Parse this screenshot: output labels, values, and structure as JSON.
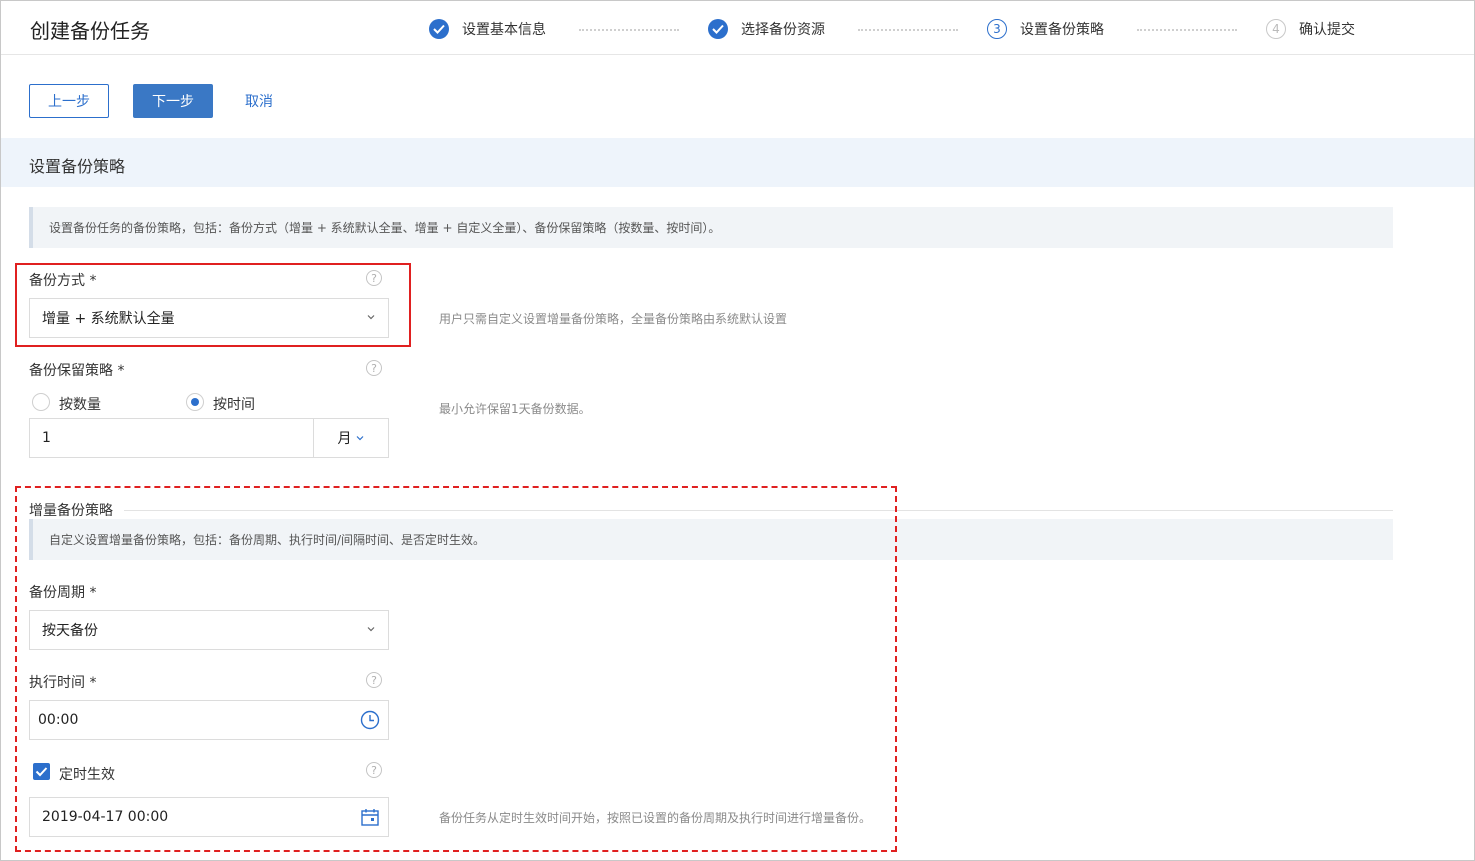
{
  "header": {
    "title": "创建备份任务",
    "steps": [
      {
        "number": "1",
        "label": "设置基本信息",
        "state": "done"
      },
      {
        "number": "2",
        "label": "选择备份资源",
        "state": "done"
      },
      {
        "number": "3",
        "label": "设置备份策略",
        "state": "current"
      },
      {
        "number": "4",
        "label": "确认提交",
        "state": "todo"
      }
    ]
  },
  "toolbar": {
    "prev_label": "上一步",
    "next_label": "下一步",
    "cancel_label": "取消"
  },
  "section": {
    "title": "设置备份策略",
    "description": "设置备份任务的备份策略，包括：备份方式（增量 + 系统默认全量、增量 + 自定义全量）、备份保留策略（按数量、按时间）。"
  },
  "backup_mode": {
    "label": "备份方式 *",
    "value": "增量 + 系统默认全量",
    "hint": "用户只需自定义设置增量备份策略，全量备份策略由系统默认设置"
  },
  "retention": {
    "label": "备份保留策略 *",
    "options": [
      {
        "label": "按数量",
        "checked": false
      },
      {
        "label": "按时间",
        "checked": true
      }
    ],
    "amount": "1",
    "unit": "月",
    "hint": "最小允许保留1天备份数据。"
  },
  "incremental": {
    "title": "增量备份策略",
    "description": "自定义设置增量备份策略，包括：备份周期、执行时间/间隔时间、是否定时生效。",
    "cycle_label": "备份周期 *",
    "cycle_value": "按天备份",
    "time_label": "执行时间 *",
    "time_value": "00:00",
    "scheduled_label": "定时生效",
    "scheduled_checked": true,
    "datetime_value": "2019-04-17 00:00",
    "datetime_hint": "备份任务从定时生效时间开始，按照已设置的备份周期及执行时间进行增量备份。"
  },
  "help_glyph": "?",
  "colors": {
    "accent": "#2c6fcc",
    "highlight_red": "#e02020",
    "band_bg": "#eef4fb"
  }
}
